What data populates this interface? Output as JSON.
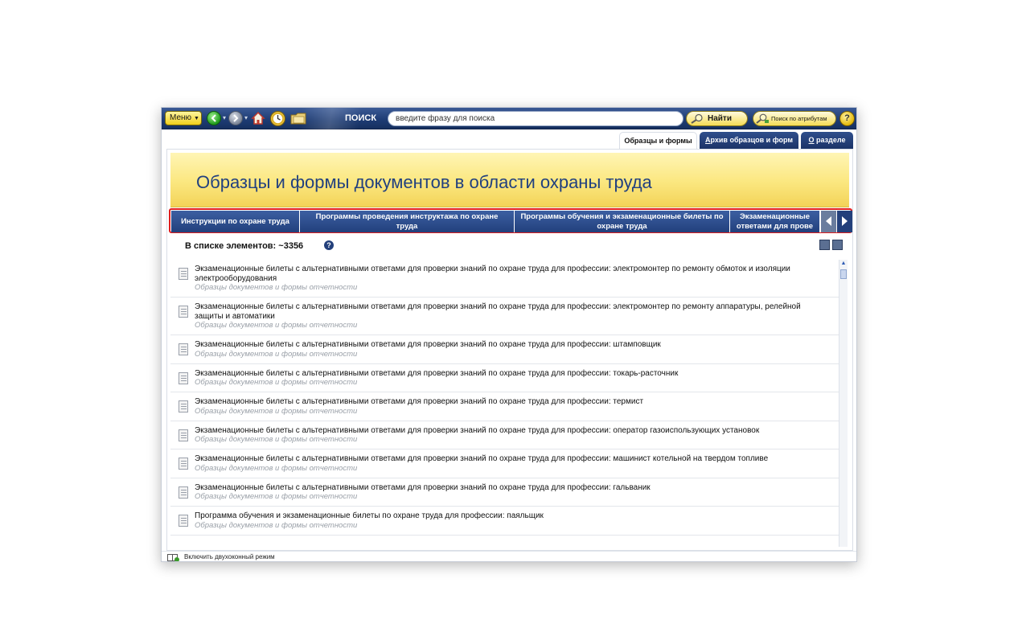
{
  "toolbar": {
    "menu_label": "Меню",
    "search_label": "ПОИСК",
    "search_placeholder": "введите фразу для поиска",
    "find_label": "Найти",
    "attr_search_label": "Поиск по атрибутам",
    "help_label": "?"
  },
  "tabs": [
    {
      "label": "Образцы и формы",
      "active": true
    },
    {
      "label": "Архив образцов и форм",
      "underline": "А",
      "rest": "рхив образцов и форм",
      "active": false
    },
    {
      "label": "О разделе",
      "underline": "О",
      "rest": " разделе",
      "active": false
    }
  ],
  "banner": {
    "title": "Образцы и формы документов в области охраны труда"
  },
  "categories": [
    "Инструкции по охране труда",
    "Программы проведения инструктажа по охране труда",
    "Программы обучения и экзаменационные билеты по охране труда",
    "Экзаменационные ответами для прове"
  ],
  "list": {
    "count_label": "В списке элементов: ~3356",
    "items": [
      {
        "title": "Экзаменационные билеты с альтернативными ответами для проверки знаний по охране труда для профессии: электромонтер по ремонту обмоток и изоляции электрооборудования",
        "subtitle": "Образцы документов и формы отчетности"
      },
      {
        "title": "Экзаменационные билеты с альтернативными ответами для проверки знаний по охране труда для профессии: электромонтер по ремонту аппаратуры, релейной защиты и автоматики",
        "subtitle": "Образцы документов и формы отчетности"
      },
      {
        "title": "Экзаменационные билеты с альтернативными ответами для проверки знаний по охране труда для профессии: штамповщик",
        "subtitle": "Образцы документов и формы отчетности"
      },
      {
        "title": "Экзаменационные билеты с альтернативными ответами для проверки знаний по охране труда для профессии: токарь-расточник",
        "subtitle": "Образцы документов и формы отчетности"
      },
      {
        "title": "Экзаменационные билеты с альтернативными ответами для проверки знаний по охране труда для профессии: термист",
        "subtitle": "Образцы документов и формы отчетности"
      },
      {
        "title": "Экзаменационные билеты с альтернативными ответами для проверки знаний по охране труда для профессии: оператор газоиспользующих установок",
        "subtitle": "Образцы документов и формы отчетности"
      },
      {
        "title": "Экзаменационные билеты с альтернативными ответами для проверки знаний по охране труда для профессии: машинист котельной на твердом топливе",
        "subtitle": "Образцы документов и формы отчетности"
      },
      {
        "title": "Экзаменационные билеты с альтернативными ответами для проверки знаний по охране труда для профессии: гальваник",
        "subtitle": "Образцы документов и формы отчетности"
      },
      {
        "title": "Программа обучения и экзаменационные билеты по охране труда для профессии: паяльщик",
        "subtitle": "Образцы документов и формы отчетности"
      }
    ]
  },
  "status": {
    "dual_window_label": "Включить двухоконный режим"
  }
}
